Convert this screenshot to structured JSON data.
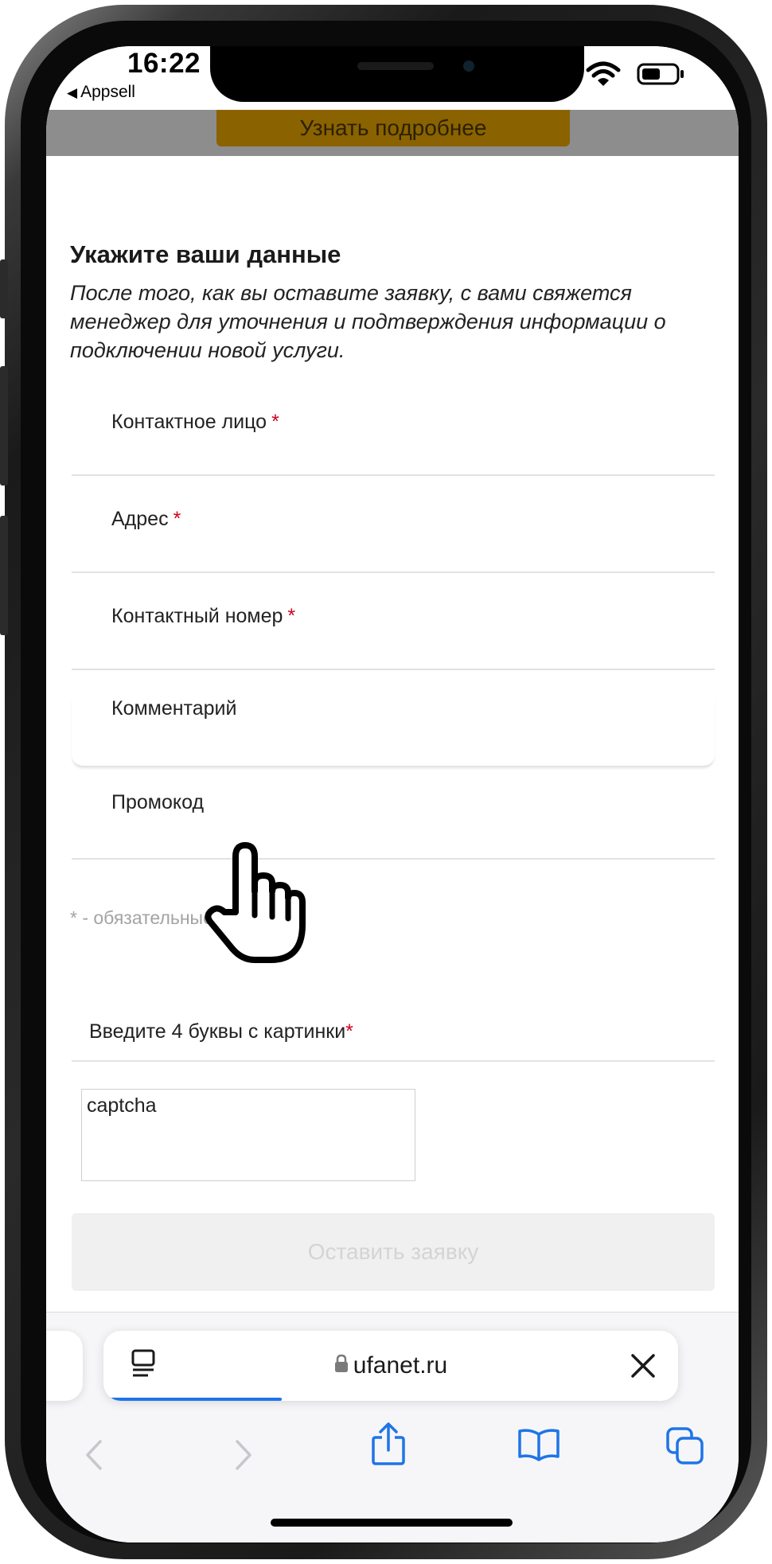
{
  "status_bar": {
    "time": "16:22",
    "back_app": "Appsell",
    "back_glyph": "◀"
  },
  "page": {
    "learn_more_label": "Узнать подробнее",
    "form_title": "Укажите ваши данные",
    "form_description": "После того, как вы оставите заявку, с вами свяжется менеджер для уточнения и подтверждения информации о подключении новой услуги.",
    "fields": [
      {
        "label": "Контактное лицо",
        "required": true
      },
      {
        "label": "Адрес",
        "required": true
      },
      {
        "label": "Контактный номер",
        "required": true
      },
      {
        "label": "Комментарий",
        "required": false
      },
      {
        "label": "Промокод",
        "required": false
      }
    ],
    "required_marker": "*",
    "required_hint": "* - обязательные поля",
    "captcha_label": "Введите 4 буквы с картинки",
    "captcha_alt": "captcha",
    "submit_label": "Оставить заявку"
  },
  "browser": {
    "url": "ufanet.ru",
    "load_progress": 0.31
  },
  "colors": {
    "accent_button": "#8a6200",
    "required": "#d0021b",
    "link_blue": "#1f74e8"
  }
}
